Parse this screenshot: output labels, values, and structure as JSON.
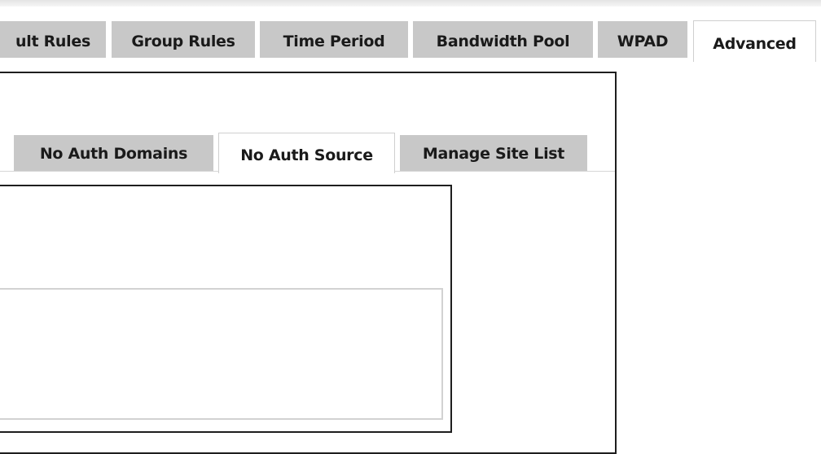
{
  "main_tabs": [
    {
      "label": "ult Rules",
      "active": false
    },
    {
      "label": "Group Rules",
      "active": false
    },
    {
      "label": "Time Period",
      "active": false
    },
    {
      "label": "Bandwidth Pool",
      "active": false
    },
    {
      "label": "WPAD",
      "active": false
    },
    {
      "label": "Advanced",
      "active": true
    }
  ],
  "sub_tabs": [
    {
      "label": "No Auth Domains",
      "active": false
    },
    {
      "label": "No Auth Source",
      "active": true
    },
    {
      "label": "Manage Site List",
      "active": false
    }
  ],
  "source_list": {
    "value": ""
  },
  "colors": {
    "tab_inactive": "#c8c8c8",
    "tab_active": "#ffffff",
    "panel_border": "#1e1e1e",
    "textbox_border": "#d2d2d2"
  }
}
